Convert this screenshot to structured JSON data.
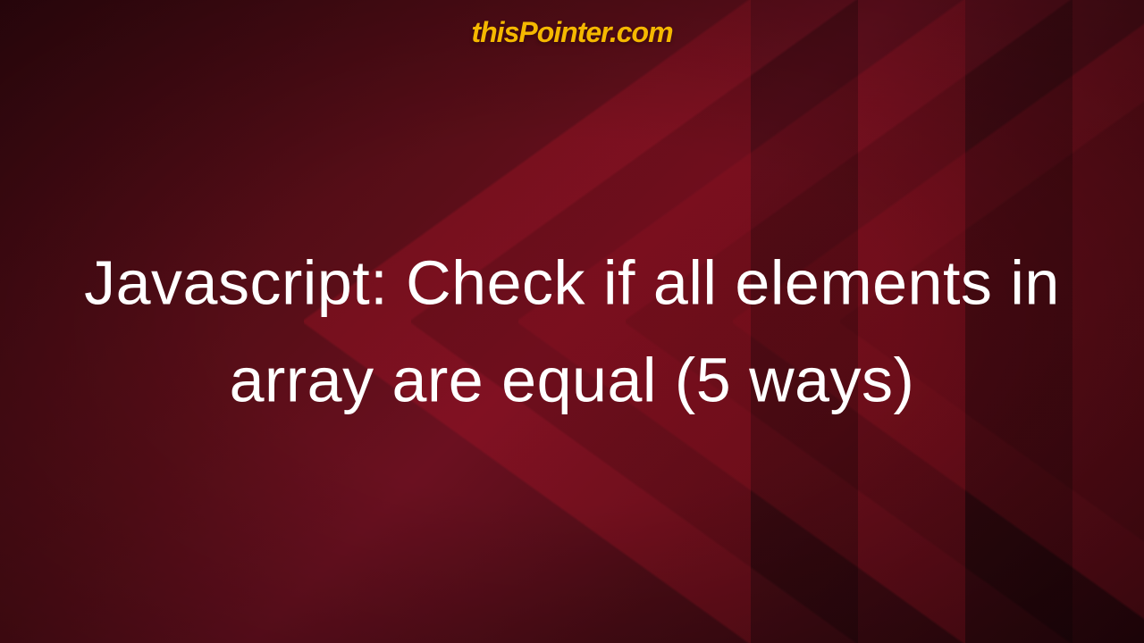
{
  "logo_text": "thisPointer.com",
  "title_text": "Javascript: Check if all elements in array are equal (5 ways)",
  "colors": {
    "logo": "#f5b800",
    "title": "#ffffff",
    "bg_dark": "#2a060c",
    "bg_mid": "#5a0e18",
    "bg_accent": "#6b1020"
  }
}
